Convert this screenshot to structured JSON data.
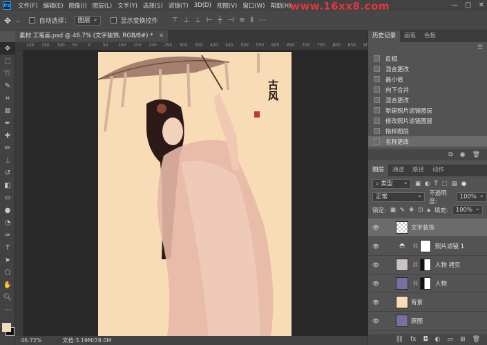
{
  "menu": {
    "logo": "Ps",
    "items": [
      "文件(F)",
      "编辑(E)",
      "图像(I)",
      "图层(L)",
      "文字(Y)",
      "选择(S)",
      "滤镜(T)",
      "3D(D)",
      "视图(V)",
      "窗口(W)",
      "帮助(H)"
    ],
    "watermark": "www.16xx8.com"
  },
  "options": {
    "auto_select_label": "自动选择：",
    "auto_select_value": "图层",
    "show_transform_label": "显示变换控件"
  },
  "document": {
    "tab_title": "素材 工笔画.psd @ 46.7% (文字装饰, RGB/8#) *",
    "ruler_labels": [
      "200",
      "150",
      "100",
      "50",
      "0",
      "50",
      "100",
      "150",
      "200",
      "250",
      "300",
      "350",
      "400",
      "450",
      "500",
      "550",
      "600",
      "650",
      "700",
      "750",
      "800",
      "850",
      "900"
    ],
    "image_text": "古风"
  },
  "status": {
    "zoom": "46.72%",
    "doc": "文档:3.19M/28.0M"
  },
  "history": {
    "tabs": [
      "历史记录",
      "画笔",
      "色板"
    ],
    "items": [
      "反相",
      "混合更改",
      "最小值",
      "向下合并",
      "混合更改",
      "新建照片滤镜图层",
      "修改照片滤镜图层",
      "拖移图层",
      "名称更改"
    ],
    "selected_index": 8
  },
  "layers": {
    "tabs": [
      "图层",
      "通道",
      "路径",
      "动作"
    ],
    "filter_label": "类型",
    "blend_mode": "正常",
    "opacity_label": "不透明度:",
    "opacity_value": "100%",
    "lock_label": "锁定:",
    "fill_label": "填充:",
    "fill_value": "100%",
    "items": [
      {
        "name": "文字装饰",
        "selected": true
      },
      {
        "name": "照片滤镜 1",
        "selected": false
      },
      {
        "name": "人物 拷贝",
        "selected": false
      },
      {
        "name": "人物",
        "selected": false
      },
      {
        "name": "背景",
        "selected": false
      },
      {
        "name": "原图",
        "selected": false
      }
    ]
  },
  "colors": {
    "foreground": "#f6dcb4",
    "background": "#111111",
    "image_bg": "#f7dcb6",
    "accent_red": "#e4363f"
  }
}
